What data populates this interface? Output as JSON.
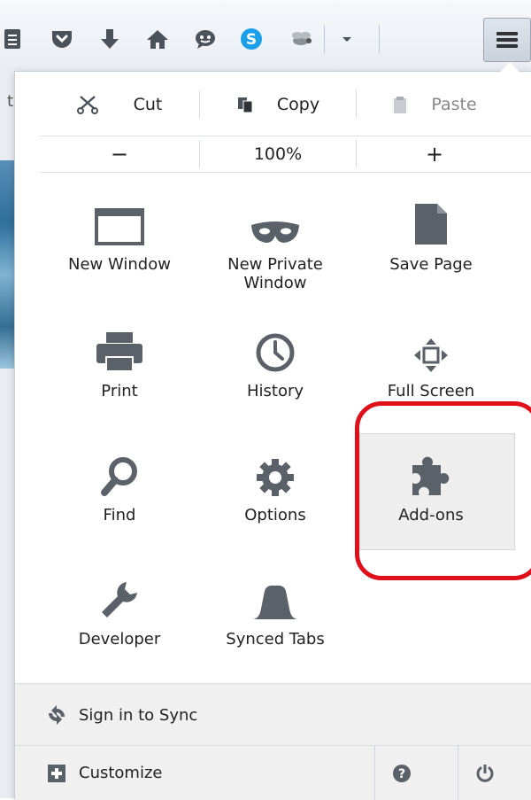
{
  "toolbar": {
    "icons": [
      "bookmarks-icon",
      "pocket-icon",
      "downloads-icon",
      "home-icon",
      "chat-icon",
      "skype-icon",
      "extension-icon",
      "overflow-icon",
      "hamburger-menu-icon"
    ]
  },
  "edit": {
    "cut": "Cut",
    "copy": "Copy",
    "paste": "Paste"
  },
  "zoom": {
    "out": "−",
    "level": "100%",
    "in": "+"
  },
  "items": {
    "new_window": "New Window",
    "new_private_line1": "New Private",
    "new_private_line2": "Window",
    "save_page": "Save Page",
    "print": "Print",
    "history": "History",
    "full_screen": "Full Screen",
    "find": "Find",
    "options": "Options",
    "addons": "Add-ons",
    "developer": "Developer",
    "synced_tabs": "Synced Tabs"
  },
  "footer": {
    "sync": "Sign in to Sync",
    "customize": "Customize"
  },
  "colors": {
    "icon": "#5a6169",
    "highlight": "#e0101a",
    "skype": "#1aa0e8",
    "hover": "#eeeeee"
  }
}
